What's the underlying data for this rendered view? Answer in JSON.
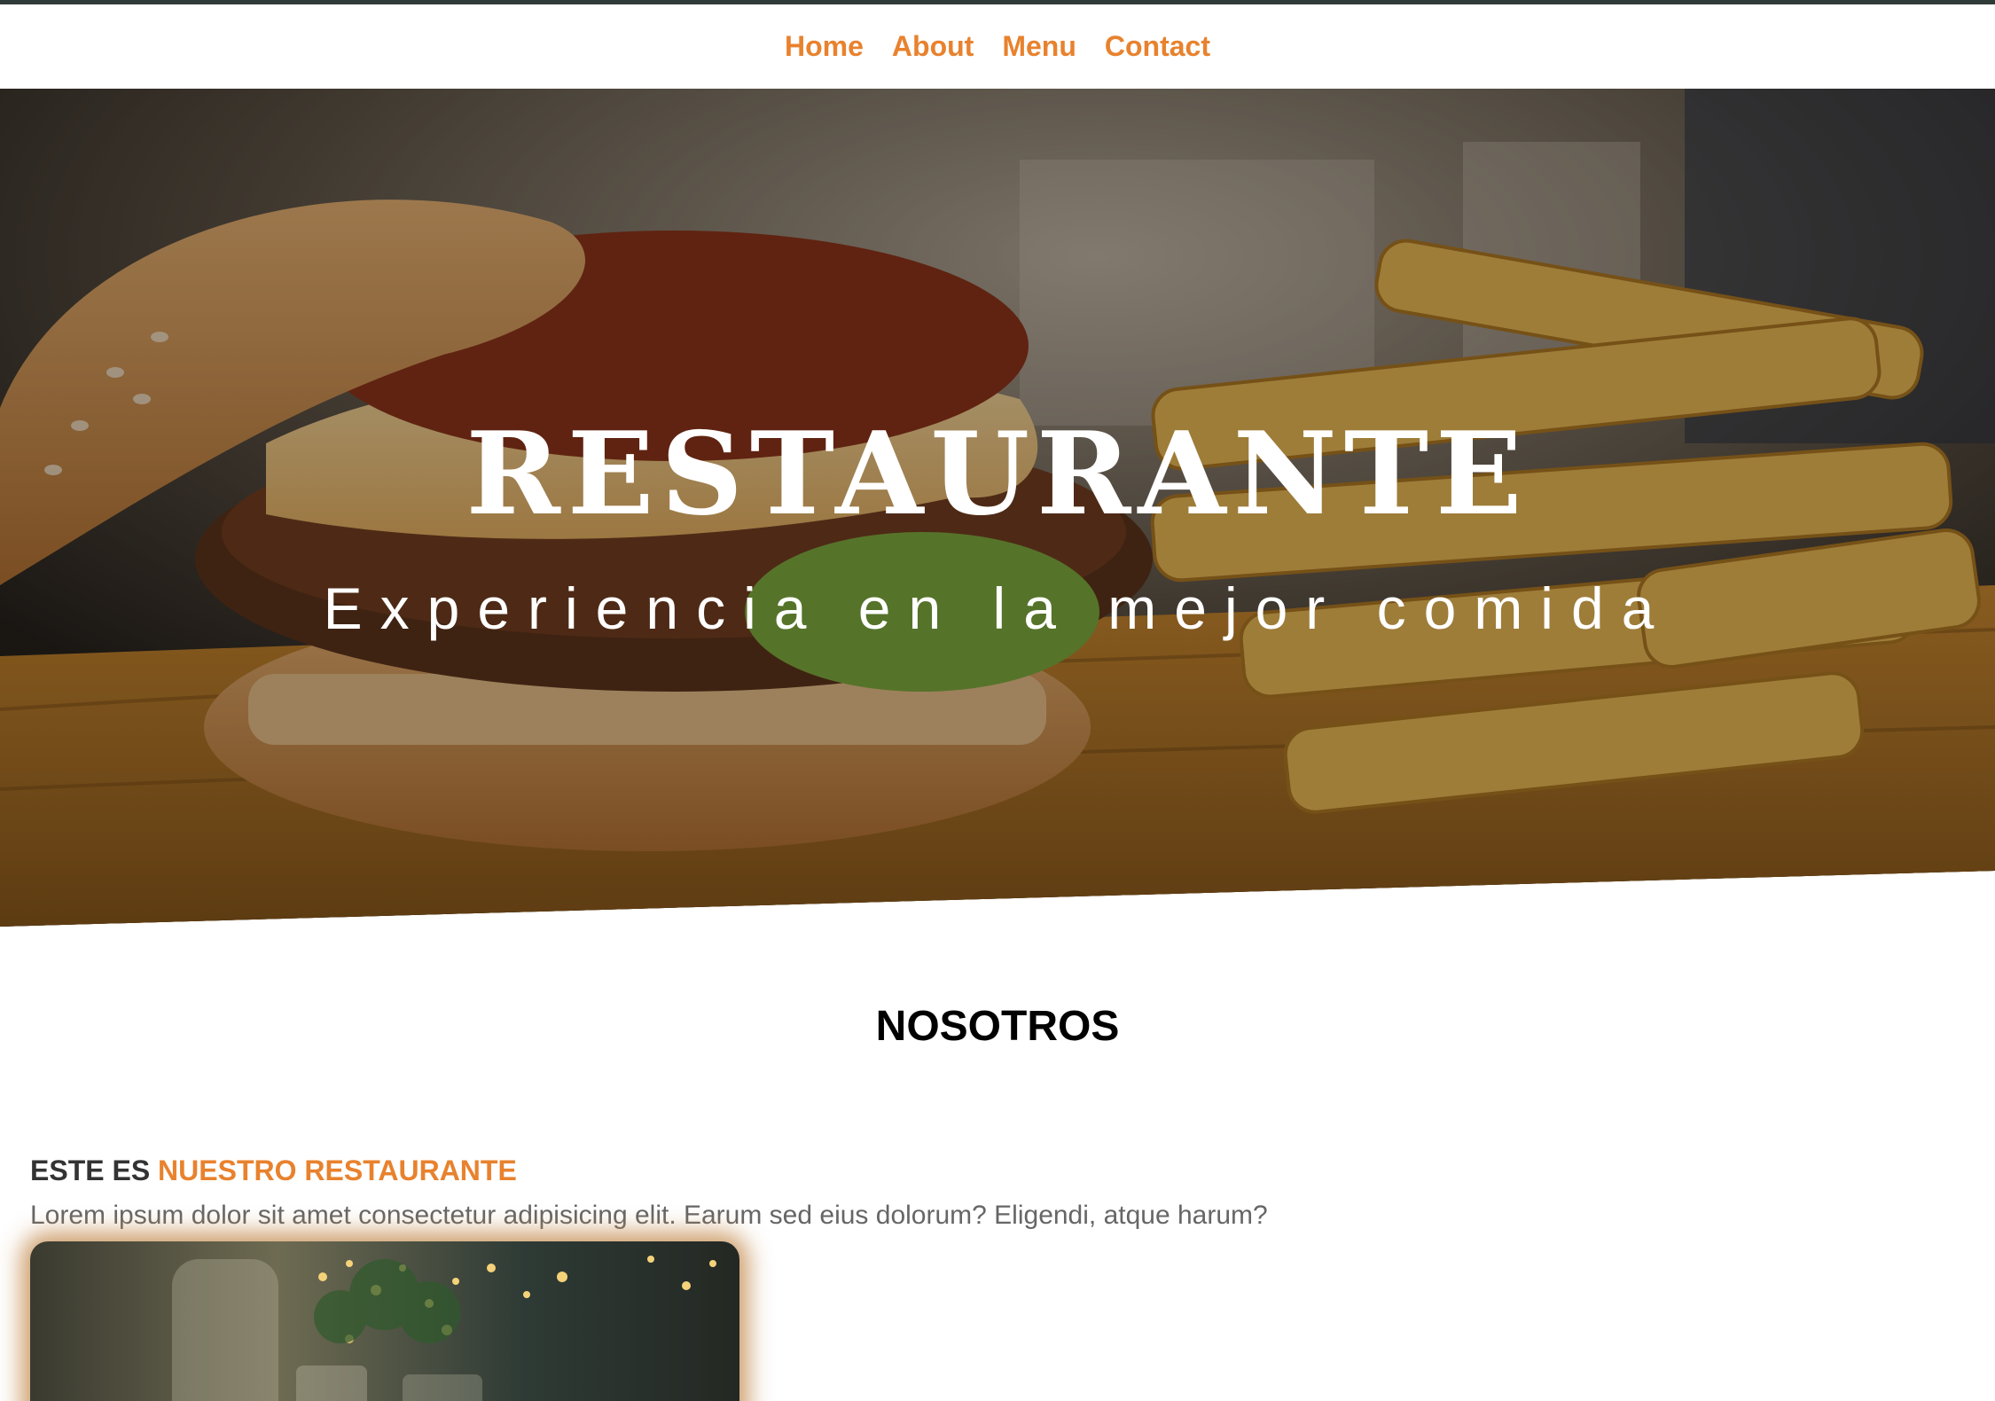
{
  "nav": {
    "items": [
      {
        "label": "Home"
      },
      {
        "label": "About"
      },
      {
        "label": "Menu"
      },
      {
        "label": "Contact"
      }
    ]
  },
  "hero": {
    "title": "RESTAURANTE",
    "subtitle": "Experiencia en la mejor comida"
  },
  "about": {
    "section_title": "NOSOTROS",
    "heading_prefix": "ESTE ES",
    "heading_accent": "NUESTRO RESTAURANTE",
    "text": "Lorem ipsum dolor sit amet consectetur adipisicing elit. Earum sed eius dolorum? Eligendi, atque harum?"
  },
  "colors": {
    "accent": "#e8822e",
    "top_strip": "#2f3b38",
    "heading_text": "#333333",
    "body_text": "#666666"
  }
}
